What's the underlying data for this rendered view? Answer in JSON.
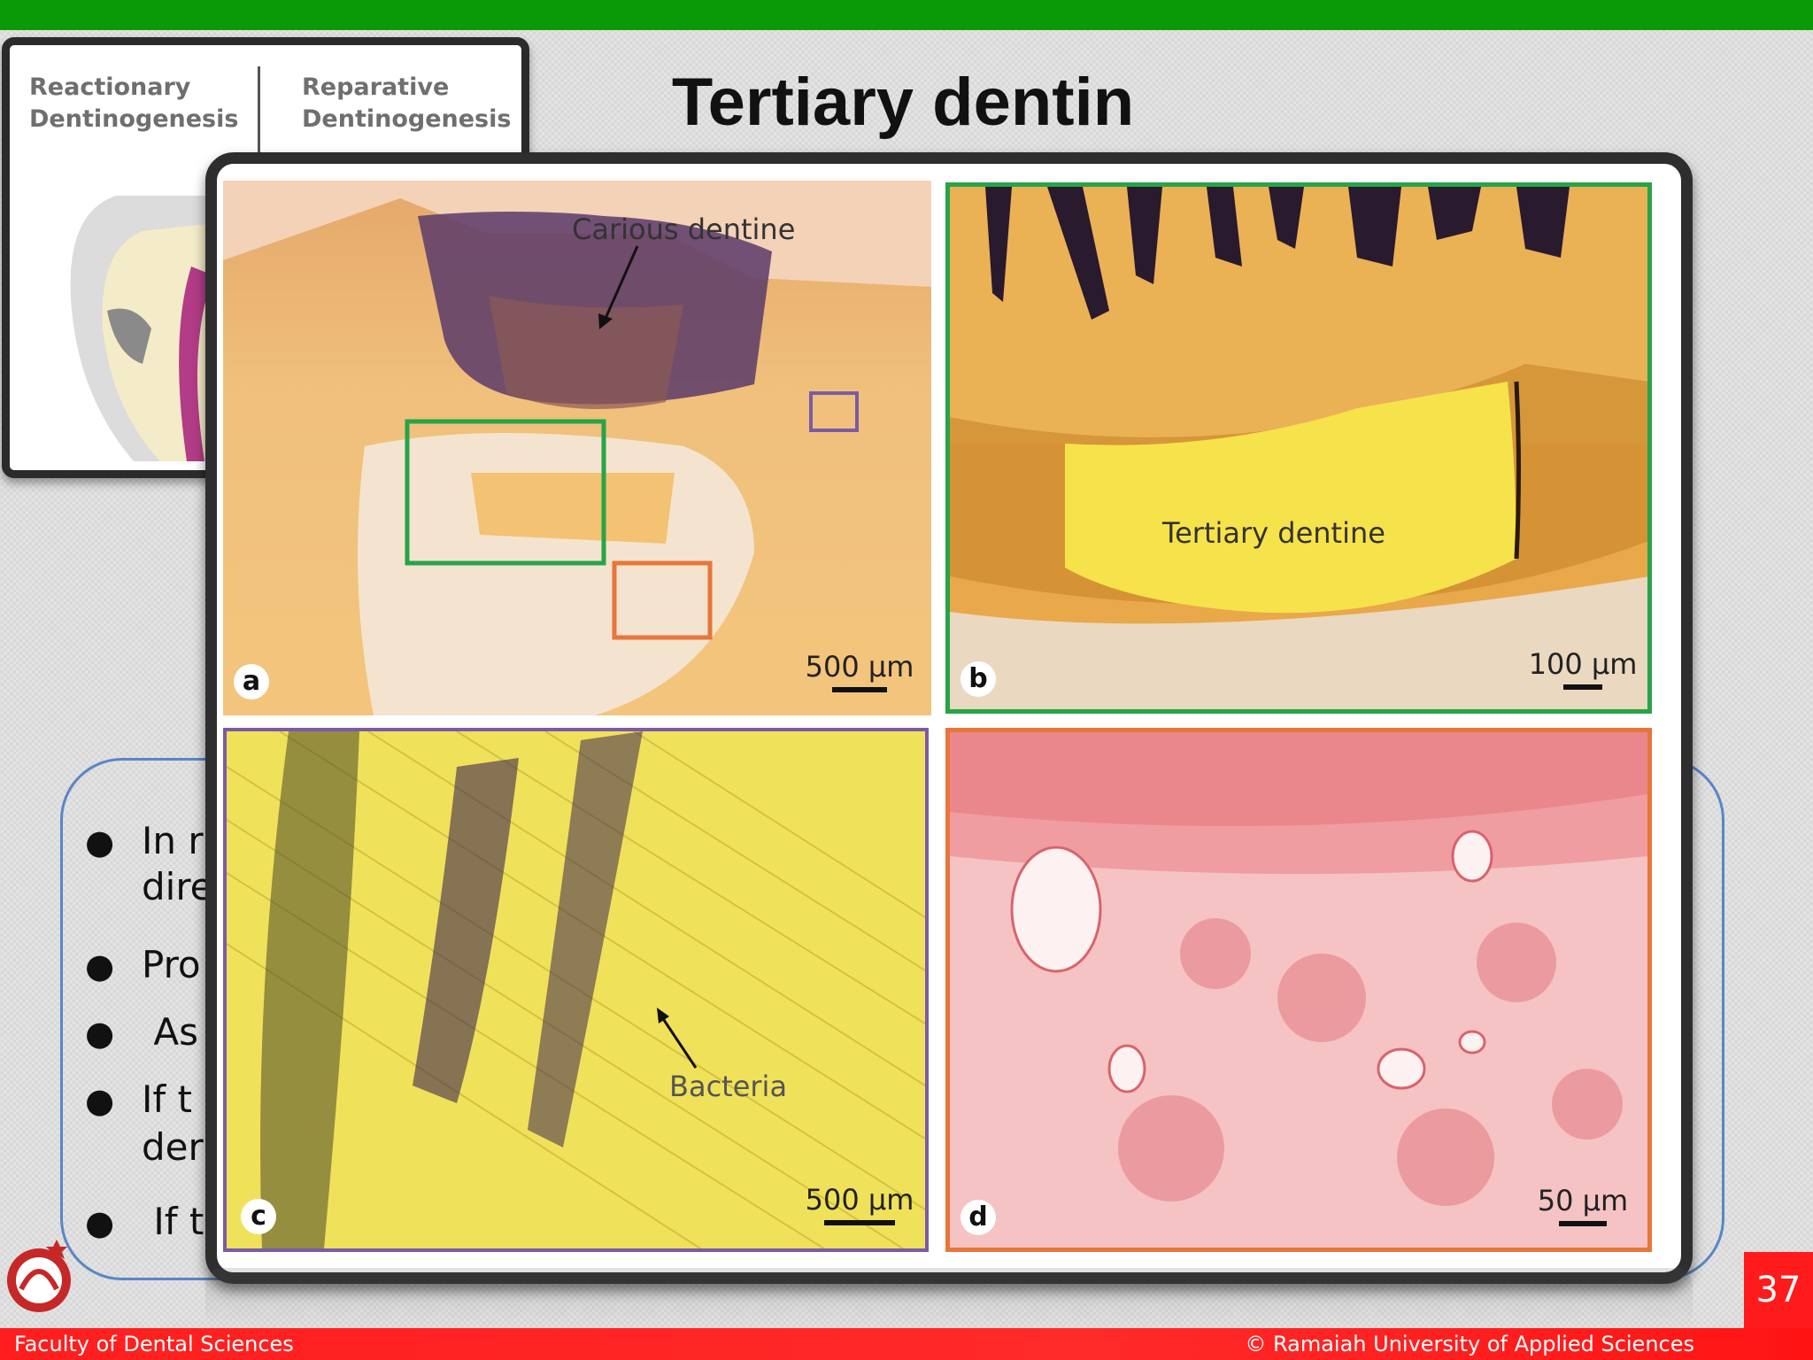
{
  "slide": {
    "title": "Tertiary dentin",
    "page_number": "37",
    "footer_left": "Faculty of Dental Sciences",
    "footer_right": "© Ramaiah University of Applied Sciences"
  },
  "inset": {
    "left_label": "Reactionary\nDentinogenesis",
    "right_label": "Reparative\nDentinogenesis"
  },
  "bullets": [
    {
      "line1": "In r",
      "line2": "dire"
    },
    {
      "line1": "Pro",
      "line2": ""
    },
    {
      "line1": " As",
      "line2": ""
    },
    {
      "line1": "If t",
      "line2": "der"
    },
    {
      "line1": " If t",
      "line2": ""
    }
  ],
  "figure": {
    "panel_a": {
      "letter": "a",
      "annotation": "Carious dentine",
      "scale": "500 µm",
      "frame_color": "#2e2e2e"
    },
    "panel_b": {
      "letter": "b",
      "annotation": "Tertiary dentine",
      "scale": "100 µm",
      "frame_color": "#27a447"
    },
    "panel_c": {
      "letter": "c",
      "annotation": "Bacteria",
      "scale": "500 µm",
      "frame_color": "#7b5ba6"
    },
    "panel_d": {
      "letter": "d",
      "annotation": "",
      "scale": "50 µm",
      "frame_color": "#e8763a"
    }
  },
  "colors": {
    "top_bar": "#0b9a07",
    "footer_bar": "#ff1e1e",
    "page_badge": "#ff1b1b",
    "bullet_box_border": "#5a86c4"
  }
}
